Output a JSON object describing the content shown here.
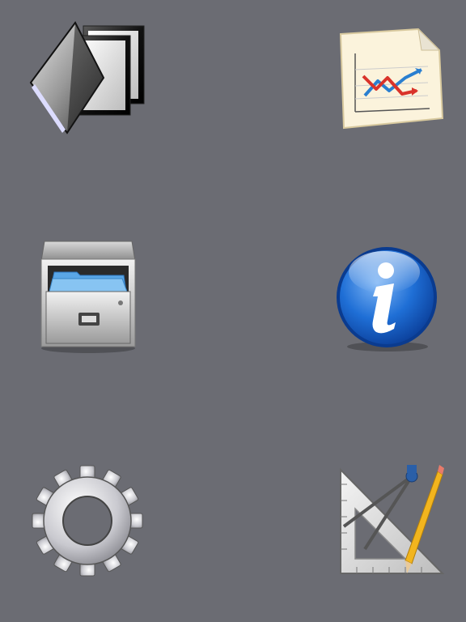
{
  "home": {
    "icons": [
      {
        "name": "documents-icon"
      },
      {
        "name": "chart-icon"
      },
      {
        "name": "file-cabinet-icon"
      },
      {
        "name": "info-icon"
      },
      {
        "name": "gear-icon"
      },
      {
        "name": "drafting-tools-icon"
      }
    ]
  },
  "colors": {
    "background": "#6b6c73",
    "info_blue": "#1f6fd6",
    "folder_blue": "#5aa6e6",
    "chart_red": "#d9332a",
    "chart_blue": "#2a7fd0",
    "pencil_yellow": "#f2b51e"
  }
}
